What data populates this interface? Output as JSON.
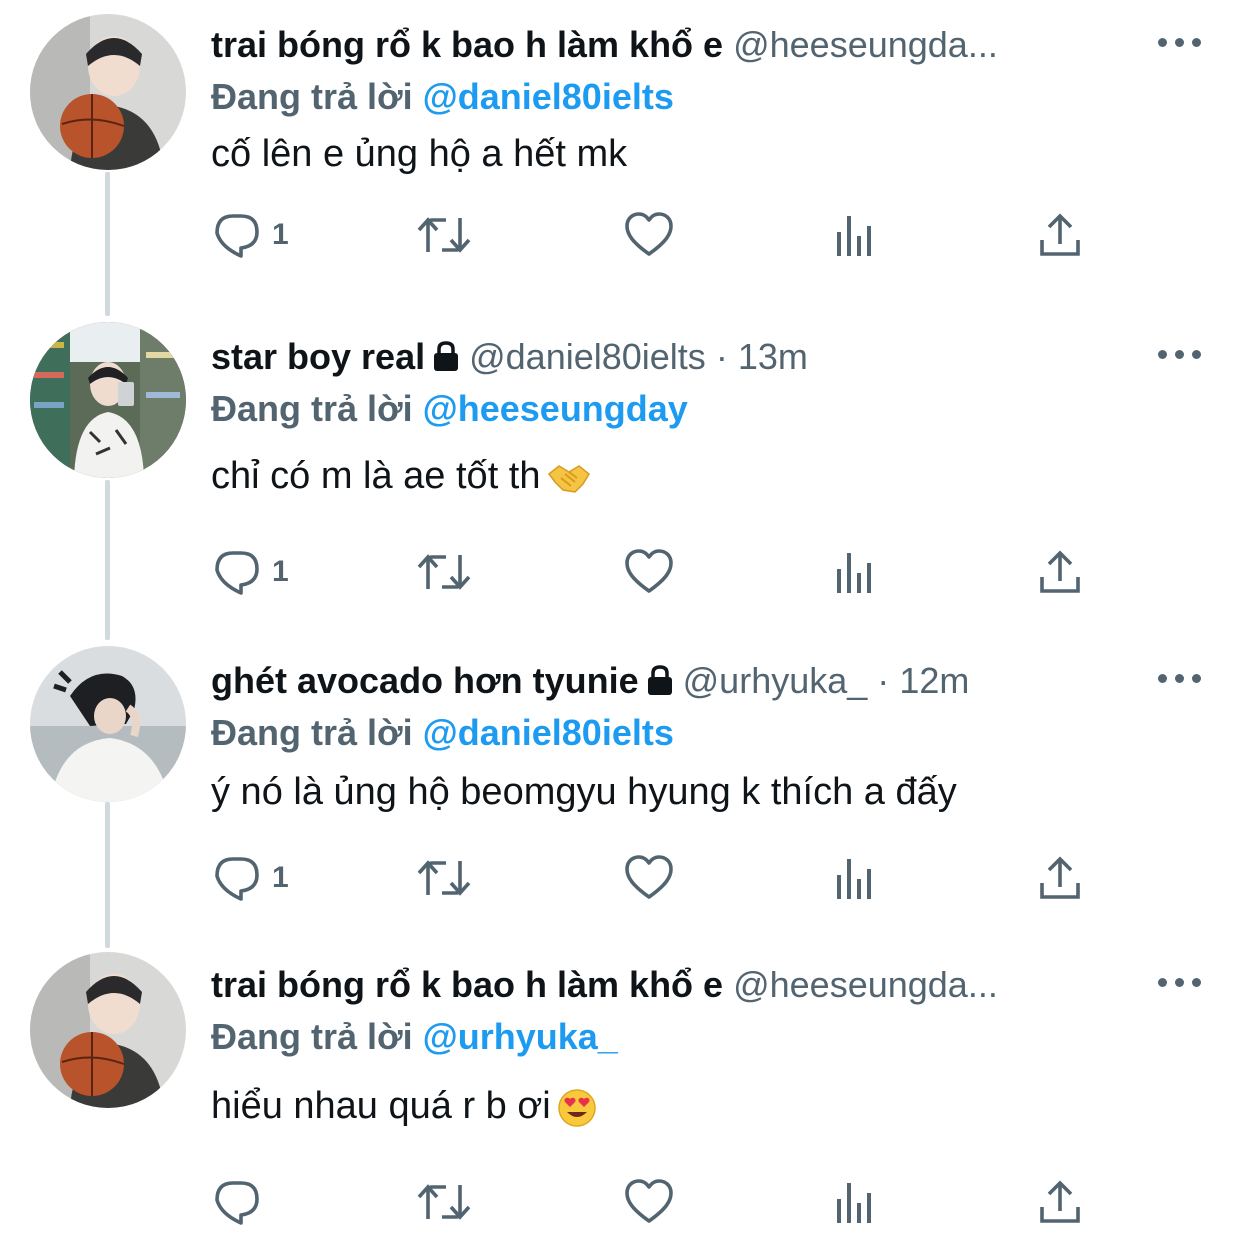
{
  "replying_to_label": "Đang trả lời",
  "tweets": [
    {
      "name": "trai bóng rổ k bao h làm khổ e",
      "protected": false,
      "handle": "@heeseungda...",
      "time_sep": "",
      "time": "",
      "reply_to": "@daniel80ielts",
      "text": "cố lên e ủng hộ a hết mk",
      "emoji": "",
      "reply_count": "1"
    },
    {
      "name": "star boy real",
      "protected": true,
      "handle": "@daniel80ielts",
      "time_sep": "·",
      "time": "13m",
      "reply_to": "@heeseungday",
      "text": "chỉ có m là ae tốt th",
      "emoji": "handshake",
      "reply_count": "1"
    },
    {
      "name": "ghét avocado hơn tyunie",
      "protected": true,
      "handle": "@urhyuka_",
      "time_sep": "·",
      "time": "12m",
      "reply_to": "@daniel80ielts",
      "text": "ý nó là ủng hộ beomgyu hyung k thích a đấy",
      "emoji": "",
      "reply_count": "1"
    },
    {
      "name": "trai bóng rổ k bao h làm khổ e",
      "protected": false,
      "handle": "@heeseungda...",
      "time_sep": "",
      "time": "",
      "reply_to": "@urhyuka_",
      "text": "hiểu nhau quá r b ơi",
      "emoji": "heart-eyes",
      "reply_count": ""
    }
  ],
  "colors": {
    "text": "#0f1419",
    "secondary": "#536471",
    "link": "#1d9bf0",
    "thread_line": "#cfd9de"
  },
  "icons": [
    "reply-icon",
    "retweet-icon",
    "like-icon",
    "views-icon",
    "share-icon",
    "more-icon",
    "lock-icon"
  ]
}
